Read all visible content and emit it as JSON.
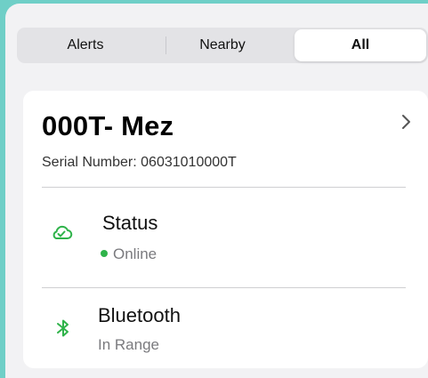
{
  "tabs": {
    "alerts_label": "Alerts",
    "nearby_label": "Nearby",
    "all_label": "All",
    "selected": "All"
  },
  "device": {
    "name": "000T- Mez",
    "serial_text": "Serial Number: 06031010000T"
  },
  "status": {
    "title": "Status",
    "value": "Online",
    "icon": "cloud-check-icon",
    "status_color": "#2fb34a"
  },
  "bluetooth": {
    "title": "Bluetooth",
    "value": "In Range",
    "icon": "bluetooth-icon"
  },
  "colors": {
    "background": "#6fcfc7",
    "accent_green": "#2fb34a"
  }
}
